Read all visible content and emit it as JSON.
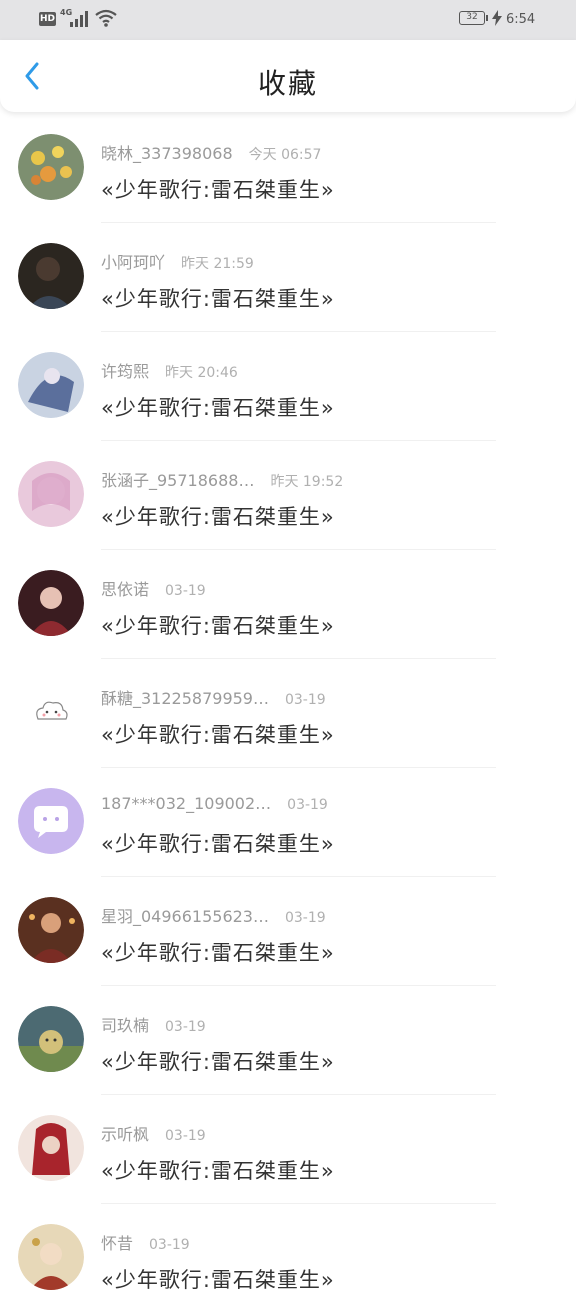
{
  "status_bar": {
    "hd": "HD",
    "net": "4G",
    "battery": "32",
    "time": "6:54"
  },
  "header": {
    "title": "收藏"
  },
  "items": [
    {
      "name": "晓林_337398068",
      "time": "今天 06:57",
      "content": "«少年歌行:雷石桀重生»"
    },
    {
      "name": "小阿珂吖",
      "time": "昨天 21:59",
      "content": "«少年歌行:雷石桀重生»"
    },
    {
      "name": "许筠熙",
      "time": "昨天 20:46",
      "content": "«少年歌行:雷石桀重生»"
    },
    {
      "name": "张涵子_95718688…",
      "time": "昨天 19:52",
      "content": "«少年歌行:雷石桀重生»"
    },
    {
      "name": "思依诺",
      "time": "03-19",
      "content": "«少年歌行:雷石桀重生»"
    },
    {
      "name": "酥糖_31225879959…",
      "time": "03-19",
      "content": "«少年歌行:雷石桀重生»"
    },
    {
      "name": "187***032_109002…",
      "time": "03-19",
      "content": "«少年歌行:雷石桀重生»"
    },
    {
      "name": "星羽_04966155623…",
      "time": "03-19",
      "content": "«少年歌行:雷石桀重生»"
    },
    {
      "name": "司玖楠",
      "time": "03-19",
      "content": "«少年歌行:雷石桀重生»"
    },
    {
      "name": "示听枫",
      "time": "03-19",
      "content": "«少年歌行:雷石桀重生»"
    },
    {
      "name": "怀昔",
      "time": "03-19",
      "content": "«少年歌行:雷石桀重生»"
    }
  ]
}
